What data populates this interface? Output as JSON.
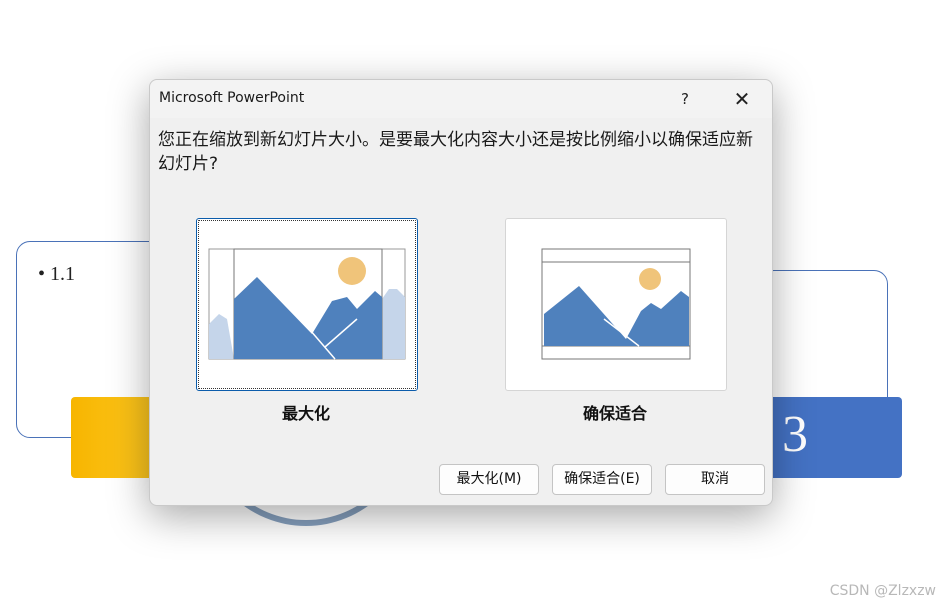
{
  "background": {
    "bullet": "• 1.1",
    "number": "3",
    "watermark": "CSDN @Zlzxzw"
  },
  "dialog": {
    "title": "Microsoft PowerPoint",
    "help_label": "?",
    "close_label": "✕",
    "message": "您正在缩放到新幻灯片大小。是要最大化内容大小还是按比例缩小以确保适应新幻灯片?",
    "options": {
      "maximize_label": "最大化",
      "fit_label": "确保适合"
    },
    "buttons": {
      "maximize": "最大化(M)",
      "fit": "确保适合(E)",
      "cancel": "取消"
    }
  },
  "colors": {
    "mountain": "#4f81bd",
    "mountain_faded": "#c5d5ea",
    "sun": "#f0c47a",
    "accent_blue": "#4472c4",
    "accent_yellow": "#ffc000"
  },
  "icons": [
    "help-icon",
    "close-icon",
    "maximize-preview-icon",
    "fit-preview-icon"
  ]
}
